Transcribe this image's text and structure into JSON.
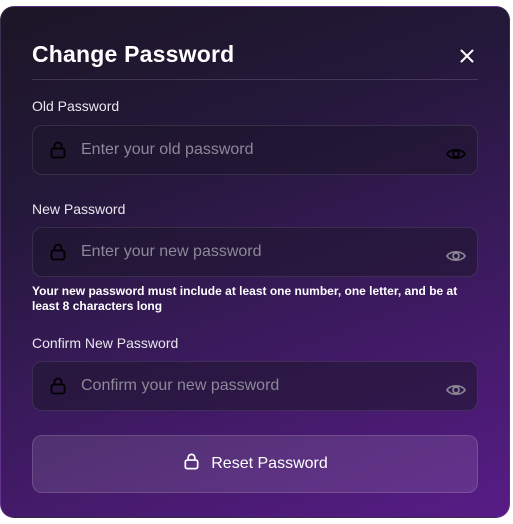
{
  "dialog": {
    "title": "Change Password",
    "close_icon": "close-icon"
  },
  "fields": {
    "old_password": {
      "label": "Old Password",
      "placeholder": "Enter your old password",
      "value": ""
    },
    "new_password": {
      "label": "New Password",
      "placeholder": "Enter your new password",
      "value": "",
      "hint": "Your new password must include at least one number, one letter, and be at least 8 characters long"
    },
    "confirm_password": {
      "label": "Confirm New Password",
      "placeholder": "Confirm your new password",
      "value": ""
    }
  },
  "actions": {
    "reset_label": "Reset Password",
    "reset_icon": "lock-icon"
  },
  "colors": {
    "background_start": "#1c1626",
    "background_end": "#571c86",
    "text": "#ffffff",
    "placeholder": "#8d8799"
  }
}
